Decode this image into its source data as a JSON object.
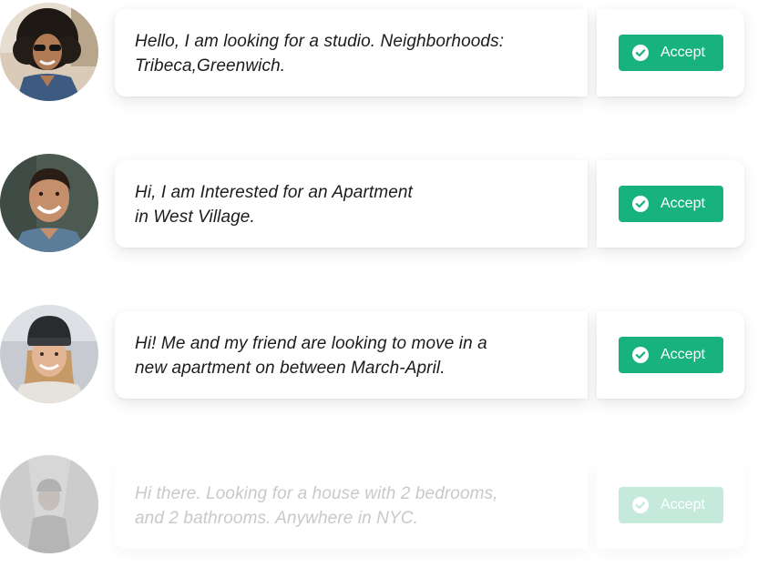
{
  "requests": [
    {
      "avatar_icon": "woman-curly-hair-sunglasses-avatar",
      "message": "Hello, I am looking for a studio. Neighborhoods:\nTribeca,Greenwich.",
      "accept_label": "Accept"
    },
    {
      "avatar_icon": "man-smiling-avatar",
      "message": "Hi, I am Interested for an Apartment\nin West Village.",
      "accept_label": "Accept"
    },
    {
      "avatar_icon": "woman-beanie-avatar",
      "message": "Hi! Me and my friend are looking to move in a\nnew apartment on between March-April.",
      "accept_label": "Accept"
    },
    {
      "avatar_icon": "man-faded-avatar",
      "message": "Hi there. Looking for a house with 2 bedrooms,\nand 2 bathrooms. Anywhere in NYC.",
      "accept_label": "Accept"
    }
  ],
  "colors": {
    "accept_green": "#17b27e",
    "text_dark": "#1c1c1c",
    "text_faded": "#c9c9c9"
  }
}
